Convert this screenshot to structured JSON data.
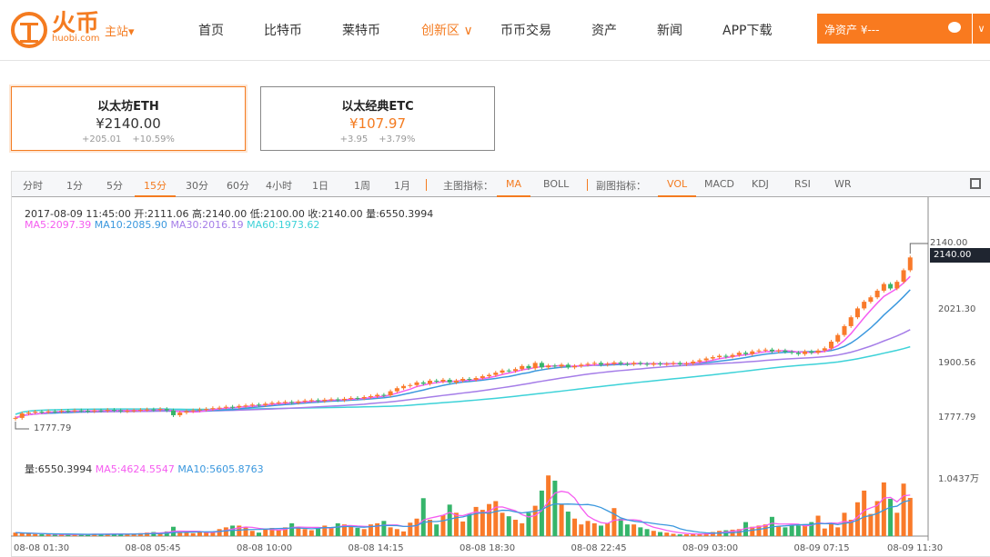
{
  "header": {
    "brand": "火币",
    "brand_sub": "huobi.com",
    "station": "主站▾",
    "nav": [
      {
        "label": "首页"
      },
      {
        "label": "比特币"
      },
      {
        "label": "莱特币"
      },
      {
        "label": "创新区 ∨",
        "active": true
      },
      {
        "label": "币币交易"
      },
      {
        "label": "资产"
      },
      {
        "label": "新闻"
      },
      {
        "label": "APP下载"
      }
    ],
    "asset_label": "净资产 ¥---",
    "asset_dropdown": "∨"
  },
  "cards": [
    {
      "title": "以太坊ETH",
      "price": "¥2140.00",
      "change": "+205.01",
      "pct": "+10.59%",
      "selected": true,
      "price_color": "#333333"
    },
    {
      "title": "以太经典ETC",
      "price": "¥107.97",
      "change": "+3.95",
      "pct": "+3.79%",
      "selected": false,
      "price_color": "#f47b20"
    }
  ],
  "toolbar": {
    "periods": [
      "分时",
      "1分",
      "5分",
      "15分",
      "30分",
      "60分",
      "4小时",
      "1日",
      "1周",
      "1月"
    ],
    "active_period": "15分",
    "main_label": "主图指标：",
    "main": [
      "MA",
      "BOLL"
    ],
    "active_main": "MA",
    "sub_label": "副图指标：",
    "sub": [
      "VOL",
      "MACD",
      "KDJ",
      "RSI",
      "WR"
    ],
    "active_sub": "VOL"
  },
  "info": {
    "line1": "2017-08-09 11:45:00  开:2111.06 高:2140.00 低:2100.00 收:2140.00 量:6550.3994",
    "ma5": "MA5:2097.39",
    "ma10": "MA10:2085.90",
    "ma30": "MA30:2016.19",
    "ma60": "MA60:1973.62",
    "vol": "量:6550.3994",
    "vma5": "MA5:4624.5547",
    "vma10": "MA10:5605.8763"
  },
  "colors": {
    "accent": "#f47b20",
    "up": "#f97a2a",
    "down": "#35b56a",
    "ma5": "#f55cf0",
    "ma10": "#3b98de",
    "ma30": "#a57de8",
    "ma60": "#3dd2d8"
  },
  "chart_data": {
    "type": "candlestick",
    "interval": "15分",
    "price_ticks": [
      2140.0,
      2021.3,
      1900.56,
      1777.79
    ],
    "price_tick_labels": [
      "2140.00",
      "2021.30",
      "1900.56",
      "1777.79"
    ],
    "current_price": "2140.00",
    "max_marker": "2140.00",
    "min_marker": "1777.79",
    "volume_tick": "1.0437万",
    "volume_max": 10437,
    "time_labels": [
      "08-08 01:30",
      "08-08 05:45",
      "08-08 10:00",
      "08-08 14:15",
      "08-08 18:30",
      "08-08 22:45",
      "08-09 03:00",
      "08-09 07:15",
      "08-09 11:30"
    ],
    "close": [
      1778,
      1788,
      1790,
      1792,
      1791,
      1793,
      1792,
      1794,
      1793,
      1795,
      1794,
      1793,
      1795,
      1794,
      1796,
      1795,
      1793,
      1794,
      1795,
      1796,
      1797,
      1796,
      1798,
      1795,
      1784,
      1790,
      1793,
      1795,
      1797,
      1798,
      1800,
      1801,
      1803,
      1802,
      1805,
      1806,
      1808,
      1807,
      1810,
      1812,
      1813,
      1814,
      1812,
      1815,
      1817,
      1818,
      1816,
      1819,
      1820,
      1818,
      1821,
      1823,
      1822,
      1825,
      1827,
      1830,
      1829,
      1838,
      1845,
      1850,
      1852,
      1858,
      1855,
      1862,
      1860,
      1864,
      1858,
      1862,
      1866,
      1864,
      1868,
      1872,
      1875,
      1880,
      1885,
      1884,
      1888,
      1895,
      1890,
      1902,
      1892,
      1896,
      1894,
      1898,
      1892,
      1895,
      1898,
      1900,
      1902,
      1898,
      1900,
      1903,
      1900,
      1899,
      1902,
      1900,
      1898,
      1901,
      1899,
      1900,
      1902,
      1899,
      1901,
      1905,
      1908,
      1912,
      1915,
      1918,
      1916,
      1920,
      1925,
      1922,
      1928,
      1930,
      1932,
      1928,
      1930,
      1927,
      1925,
      1922,
      1928,
      1925,
      1930,
      1935,
      1950,
      1965,
      1985,
      2005,
      2025,
      2040,
      2050,
      2065,
      2080,
      2070,
      2085,
      2111.06,
      2140
    ],
    "volume": [
      600,
      500,
      400,
      350,
      300,
      300,
      250,
      250,
      300,
      250,
      300,
      350,
      400,
      350,
      300,
      400,
      350,
      300,
      400,
      500,
      600,
      700,
      500,
      800,
      1600,
      700,
      600,
      500,
      650,
      700,
      800,
      1200,
      1500,
      1800,
      1800,
      1500,
      900,
      600,
      1200,
      1400,
      1100,
      1500,
      2200,
      1600,
      1200,
      1000,
      1500,
      1800,
      1400,
      2200,
      2000,
      1600,
      1400,
      1200,
      2000,
      2200,
      2600,
      1500,
      1200,
      800,
      2300,
      3000,
      6500,
      2800,
      2000,
      3600,
      5400,
      4000,
      2500,
      3800,
      5000,
      4500,
      5500,
      6000,
      4000,
      3400,
      2800,
      2200,
      4000,
      5200,
      7800,
      10400,
      9500,
      5500,
      4200,
      3000,
      2000,
      2600,
      2200,
      1800,
      2200,
      4800,
      3000,
      2000,
      2000,
      1500,
      1200,
      900,
      700,
      600,
      400,
      300,
      300,
      350,
      400,
      500,
      700,
      900,
      1000,
      1100,
      1200,
      2400,
      1600,
      1800,
      2000,
      3300,
      1700,
      1500,
      1900,
      1800,
      1800,
      2400,
      3500,
      1300,
      2300,
      1500,
      4000,
      2800,
      5800,
      7800,
      3800,
      6000,
      9200,
      6400,
      4000,
      9000,
      6550.3994
    ]
  }
}
